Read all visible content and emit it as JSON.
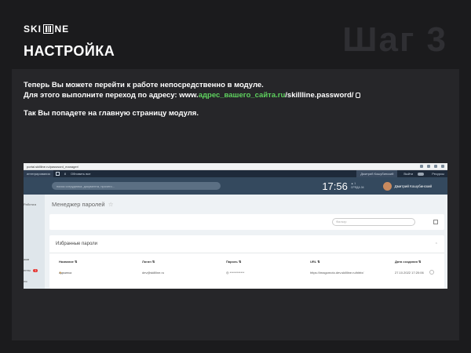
{
  "brand": {
    "logo_left": "SKI",
    "logo_right": "NE"
  },
  "header": {
    "title": "НАСТРОЙКА",
    "step": "Шаг 3"
  },
  "instructions": {
    "line1": "Теперь Вы можете перейти к работе непосредственно в модуле.",
    "line2_prefix": "Для этого выполните переход по адресу: www.",
    "line2_link": "адрес_вашего_сайта.ru",
    "line2_suffix": "/skillline.password/",
    "line3": "Так Вы попадете на главную страницу модуля."
  },
  "screenshot": {
    "url": "portal.skillline.ru/password_manager/",
    "topbar": {
      "item1": "интегрирования",
      "item2": "8",
      "item3": "Обновить все",
      "user": "Дмитрий Кошубинский",
      "logout": "Выйти",
      "resources": "Ресурсы"
    },
    "search_placeholder": "поиск сотрудника, документа, прочего...",
    "time": "17:56",
    "date_top": "▲ 1",
    "date_bottom": "СРЕДА 04",
    "user_name": "Дмитрий Кошубинский",
    "left_items": {
      "hs": "Работа ▸",
      "m1": "ами",
      "m2": "енты",
      "m2_badge": "1",
      "m3": "ля"
    },
    "page_title": "Менеджер паролей",
    "page_title_star": "☆",
    "filter_placeholder": "Фильтр",
    "favorites_title": "Избранные пароли",
    "favorites_chevron": "⌃",
    "columns": [
      "Название ⇅",
      "Логин ⇅",
      "Пароль ⇅",
      "URL ⇅",
      "Дата создания ⇅"
    ],
    "row": {
      "star": "★",
      "name": "Админка",
      "login": "dev@skillline.ru",
      "password": "◎  ************",
      "url": "https://imagomoto.dev.skillline.ru/bitrix/",
      "date": "27.10.2022 17:20:06"
    }
  }
}
